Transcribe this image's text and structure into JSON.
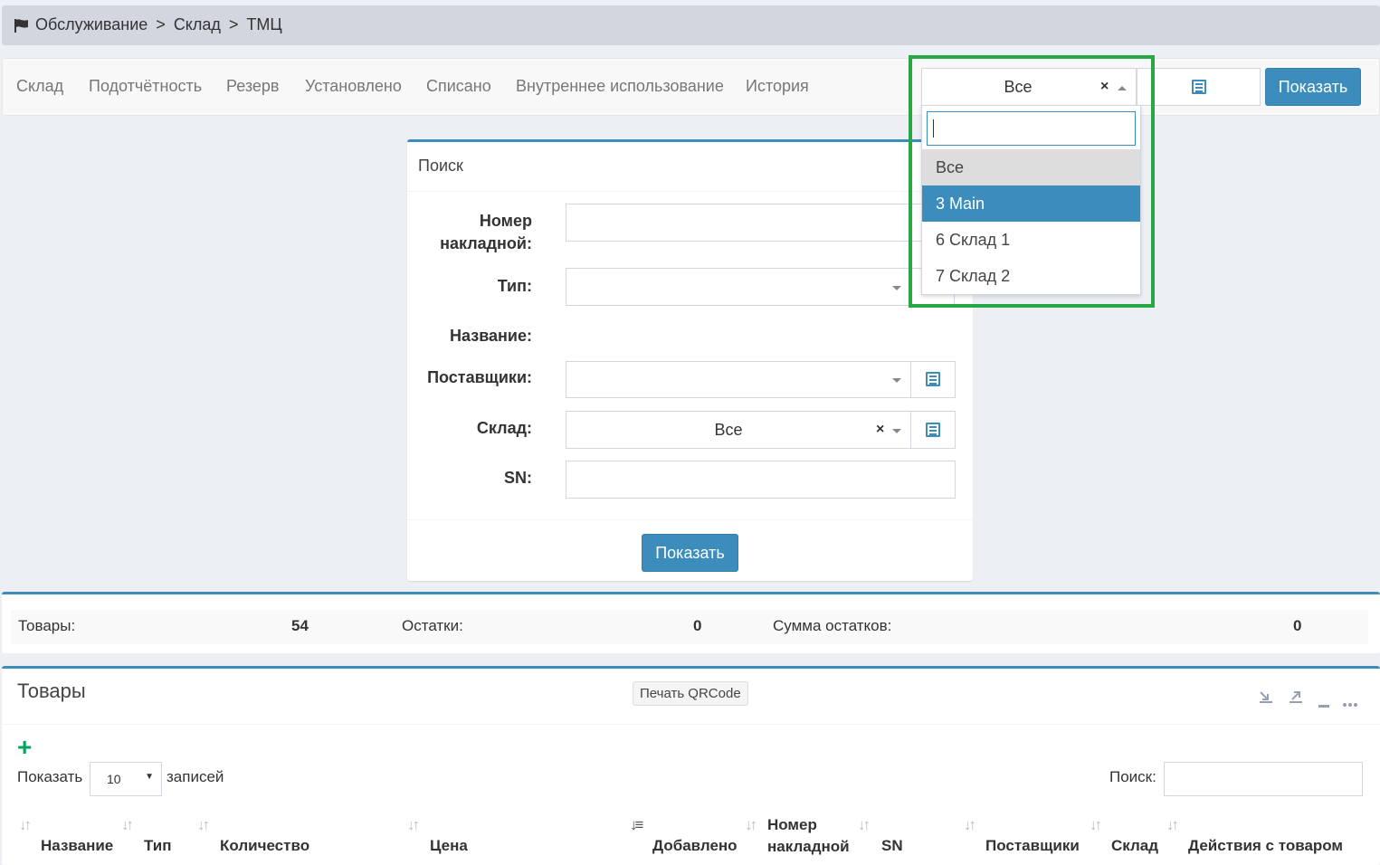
{
  "breadcrumb": {
    "icon": "flag-icon",
    "items": [
      "Обслуживание",
      "Склад",
      "ТМЦ"
    ],
    "separator": ">"
  },
  "tabs": [
    "Склад",
    "Подотчётность",
    "Резерв",
    "Установлено",
    "Списано",
    "Внутреннее использование",
    "История"
  ],
  "top_filter": {
    "warehouse_value": "Все",
    "clear": "×",
    "show_button": "Показать",
    "dropdown": {
      "search_value": "",
      "options": [
        "Все",
        "3 Main",
        "6 Склад 1",
        "7 Склад 2"
      ],
      "hovered": "Все",
      "highlighted": "3 Main"
    }
  },
  "search_panel": {
    "title": "Поиск",
    "labels": {
      "invoice_line1": "Номер",
      "invoice_line2": "накладной:",
      "type": "Тип:",
      "name": "Название:",
      "suppliers": "Поставщики:",
      "warehouse": "Склад:",
      "sn": "SN:"
    },
    "warehouse_value": "Все",
    "clear": "×",
    "show_button": "Показать"
  },
  "stats": {
    "goods_label": "Товары:",
    "goods_value": "54",
    "remains_label": "Остатки:",
    "remains_value": "0",
    "sum_label": "Сумма остатков:",
    "sum_value": "0"
  },
  "products": {
    "title": "Товары",
    "qr_button": "Печать QRCode",
    "show_label": "Показать",
    "page_length": "10",
    "records_label": "записей",
    "search_label": "Поиск:",
    "columns": {
      "name": "Название",
      "type": "Тип",
      "quantity": "Количество",
      "price": "Цена",
      "added": "Добавлено",
      "invoice_line1": "Номер",
      "invoice_line2": "накладной",
      "sn": "SN",
      "suppliers": "Поставщики",
      "warehouse": "Склад",
      "actions": "Действия с товаром"
    }
  },
  "colors": {
    "primary": "#3c8dbc",
    "highlight_border": "#28a745",
    "add_green": "#00a65a",
    "background": "#ecf0f5"
  }
}
